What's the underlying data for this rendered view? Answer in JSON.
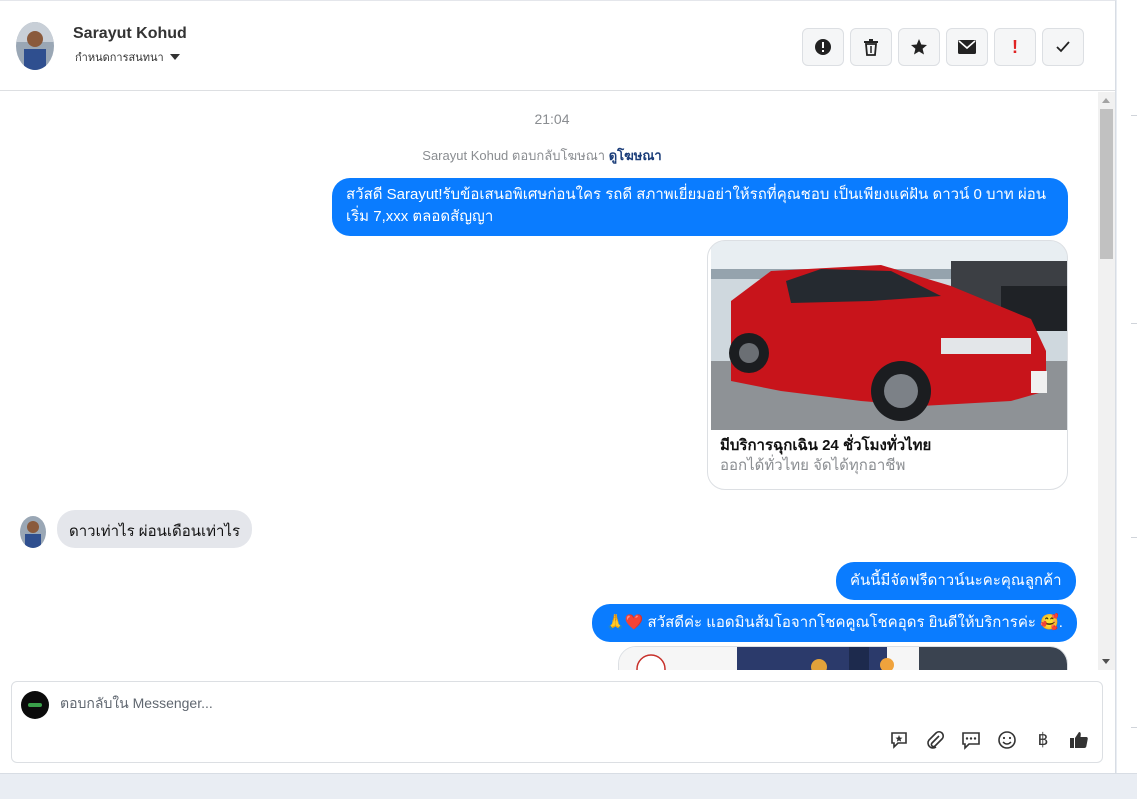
{
  "header": {
    "contact_name": "Sarayut Kohud",
    "assign_label": "กำหนดการสนทนา",
    "actions": [
      {
        "name": "report-spam-button",
        "icon": "alert-circle-icon"
      },
      {
        "name": "delete-button",
        "icon": "trash-icon"
      },
      {
        "name": "star-button",
        "icon": "star-icon"
      },
      {
        "name": "mark-unread-button",
        "icon": "envelope-icon"
      },
      {
        "name": "important-button",
        "icon": "exclamation-icon"
      },
      {
        "name": "mark-done-button",
        "icon": "check-icon"
      }
    ]
  },
  "conversation": {
    "time": "21:04",
    "reply_note": "Sarayut Kohud ตอบกลับโฆษณา",
    "reply_link": "ดูโฆษณา",
    "messages": {
      "ad_greeting": "สวัสดี Sarayut!รับข้อเสนอพิเศษก่อนใคร รถดี สภาพเยี่ยมอย่าให้รถที่คุณชอบ เป็นเพียงแค่ฝัน ดาวน์ 0 บาท ผ่อนเริ่ม 7,xxx ตลอดสัญญา",
      "card_title": "มีบริการฉุกเฉิน 24 ชั่วโมงทั่วไทย",
      "card_subtitle": "ออกได้ทั่วไทย จัดได้ทุกอาชีพ",
      "customer_question": "ดาวเท่าไร  ผ่อนเดือนเท่าไร",
      "reply_1": "คันนี้มีจัดฟรีดาวน์นะคะคุณลูกค้า",
      "reply_2": "🙏❤️ สวัสดีค่ะ แอดมินส้มโอจากโชคคูณโชคอุดร ยินดีให้บริการค่ะ  🥰."
    }
  },
  "composer": {
    "placeholder": "ตอบกลับใน Messenger...",
    "tools": [
      "saved-reply-icon",
      "attachment-icon",
      "message-icon",
      "emoji-icon",
      "baht-icon",
      "thumbs-up-icon"
    ]
  },
  "colors": {
    "outgoing_bubble": "#0a7cff",
    "incoming_bubble": "#e4e6eb",
    "important": "#e02424"
  }
}
